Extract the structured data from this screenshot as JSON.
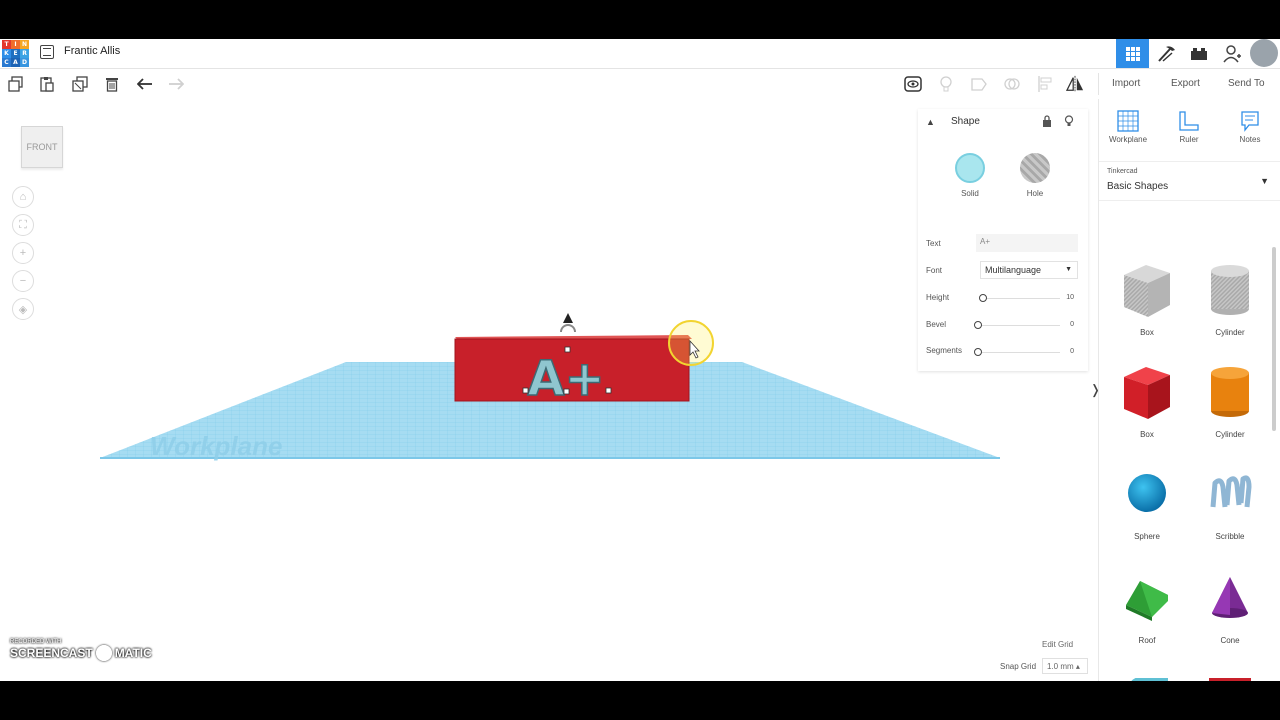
{
  "app": {
    "logo_letters": [
      "T",
      "I",
      "N",
      "K",
      "E",
      "R",
      "C",
      "A",
      "D"
    ],
    "design_title": "Frantic Allis"
  },
  "topbar": {
    "icons": [
      "grid-view-icon",
      "hammer-pickaxe-icon",
      "brick-icon",
      "add-user-icon"
    ]
  },
  "toolbar": {
    "import_label": "Import",
    "export_label": "Export",
    "send_to_label": "Send To"
  },
  "viewcube": {
    "face_label": "FRONT"
  },
  "scene": {
    "workplane_label": "Workplane",
    "text_glyphs": "A+"
  },
  "shape_panel": {
    "title": "Shape",
    "solid_label": "Solid",
    "hole_label": "Hole",
    "text_label": "Text",
    "text_value": "A+",
    "font_label": "Font",
    "font_value": "Multilanguage",
    "height_label": "Height",
    "height_value": "10",
    "bevel_label": "Bevel",
    "bevel_value": "0",
    "segments_label": "Segments",
    "segments_value": "0",
    "colors": {
      "solid": "#a9e6ee",
      "hole": "#bdbdbd"
    }
  },
  "library": {
    "tools": [
      {
        "label": "Workplane"
      },
      {
        "label": "Ruler"
      },
      {
        "label": "Notes"
      }
    ],
    "category_small": "Tinkercad",
    "category_name": "Basic Shapes",
    "shapes": [
      {
        "label": "Box"
      },
      {
        "label": "Cylinder"
      },
      {
        "label": "Box"
      },
      {
        "label": "Cylinder"
      },
      {
        "label": "Sphere"
      },
      {
        "label": "Scribble"
      },
      {
        "label": "Roof"
      },
      {
        "label": "Cone"
      }
    ]
  },
  "bottom": {
    "edit_grid": "Edit Grid",
    "snap_grid_label": "Snap Grid",
    "snap_grid_value": "1.0 mm ▴"
  },
  "watermark": {
    "top": "RECORDED WITH",
    "left": "SCREENCAST",
    "right": "MATIC"
  }
}
